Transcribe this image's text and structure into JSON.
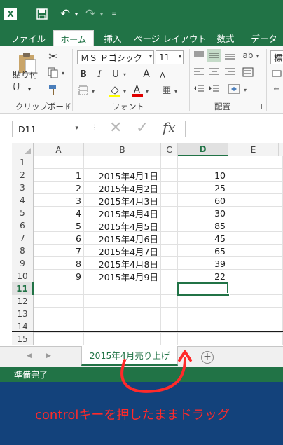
{
  "app": {
    "name": "Excel"
  },
  "quick_access": {
    "logo_letter": "X",
    "icons": [
      "excel-logo-icon",
      "save-icon",
      "undo-icon",
      "redo-icon",
      "customize-icon"
    ],
    "undo_glyph": "↶",
    "redo_glyph": "↷",
    "dropdown_glyph": "▾",
    "more_glyph": "="
  },
  "tabs": [
    {
      "label": "ファイル",
      "active": false
    },
    {
      "label": "ホーム",
      "active": true
    },
    {
      "label": "挿入",
      "active": false
    },
    {
      "label": "ページ レイアウト",
      "active": false
    },
    {
      "label": "数式",
      "active": false
    },
    {
      "label": "データ",
      "active": false
    }
  ],
  "ribbon": {
    "clipboard": {
      "label": "クリップボード",
      "paste_label": "貼り付け"
    },
    "font": {
      "label": "フォント",
      "font_name": "ＭＳ Ｐゴシック",
      "font_size": "11",
      "bold": "B",
      "italic": "I",
      "underline": "U",
      "grow": "A",
      "shrink": "A",
      "highlight_color": "#ffff00",
      "font_color": "#e00000"
    },
    "alignment": {
      "label": "配置",
      "wrap_label": "標準"
    }
  },
  "formula_bar": {
    "name_box": "D11",
    "dots": "⋮",
    "cancel": "✕",
    "enter": "✓",
    "fx": "fx",
    "value": ""
  },
  "grid": {
    "columns": [
      "A",
      "B",
      "C",
      "D",
      "E"
    ],
    "selected_column": "D",
    "selected_row": "11",
    "rows": [
      {
        "n": "1",
        "a": "",
        "b": "",
        "d": ""
      },
      {
        "n": "2",
        "a": "1",
        "b": "2015年4月1日",
        "d": "10"
      },
      {
        "n": "3",
        "a": "2",
        "b": "2015年4月2日",
        "d": "25"
      },
      {
        "n": "4",
        "a": "3",
        "b": "2015年4月3日",
        "d": "60"
      },
      {
        "n": "5",
        "a": "4",
        "b": "2015年4月4日",
        "d": "30"
      },
      {
        "n": "6",
        "a": "5",
        "b": "2015年4月5日",
        "d": "85"
      },
      {
        "n": "7",
        "a": "6",
        "b": "2015年4月6日",
        "d": "45"
      },
      {
        "n": "8",
        "a": "7",
        "b": "2015年4月7日",
        "d": "65"
      },
      {
        "n": "9",
        "a": "8",
        "b": "2015年4月8日",
        "d": "39"
      },
      {
        "n": "10",
        "a": "9",
        "b": "2015年4月9日",
        "d": "22"
      },
      {
        "n": "11",
        "a": "",
        "b": "",
        "d": ""
      },
      {
        "n": "12",
        "a": "",
        "b": "",
        "d": ""
      },
      {
        "n": "13",
        "a": "",
        "b": "",
        "d": ""
      },
      {
        "n": "14",
        "a": "",
        "b": "",
        "d": ""
      },
      {
        "n": "15",
        "a": "",
        "b": "",
        "d": ""
      }
    ]
  },
  "sheets": {
    "nav_prev": "◀",
    "nav_next": "▶",
    "active_tab": "2015年4月売り上げ",
    "new_sheet": "+"
  },
  "status": {
    "text": "準備完了"
  },
  "annotation": {
    "caption": "controlキーを押したままドラッグ",
    "color": "#ff2a2a"
  },
  "colors": {
    "accent": "#217346",
    "background": "#13427b"
  }
}
